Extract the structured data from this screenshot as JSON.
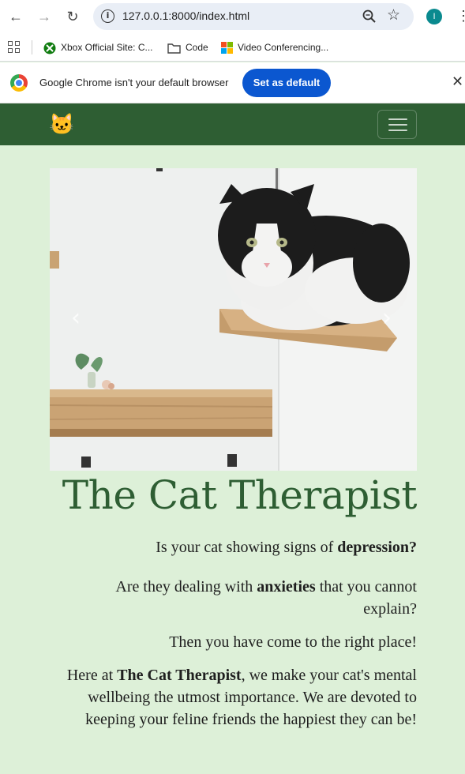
{
  "browser": {
    "url": "127.0.0.1:8000/index.html",
    "profile_initial": "I",
    "bookmarks": [
      {
        "label": "Xbox Official Site: C...",
        "icon": "xbox-icon"
      },
      {
        "label": "Code",
        "icon": "folder-icon"
      },
      {
        "label": "Video Conferencing...",
        "icon": "windows-icon"
      }
    ],
    "infobar": {
      "message": "Google Chrome isn't your default browser",
      "button": "Set as default"
    }
  },
  "site": {
    "brand_icon": "🐱",
    "title": "The Cat Therapist",
    "p1_pre": "Is your cat showing signs of ",
    "p1_bold": "depression?",
    "p2_pre": "Are they dealing with ",
    "p2_bold": "anxieties",
    "p2_post": " that you cannot explain?",
    "p3": "Then you have come to the right place!",
    "p4_pre": "Here at ",
    "p4_bold": "The Cat Therapist",
    "p4_post": ", we make your cat's mental wellbeing the utmost importance. We are devoted to keeping your feline friends the happiest they can be!"
  },
  "colors": {
    "navbar": "#2e5e33",
    "page_bg": "#ddf0d8",
    "title": "#2e5e33"
  }
}
